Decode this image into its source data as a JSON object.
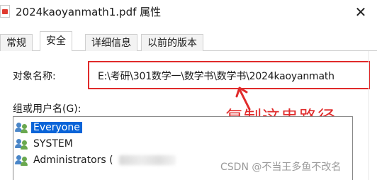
{
  "window": {
    "title": "2024kaoyanmath1.pdf 属性",
    "file_icon": "pdf-file-icon",
    "close_glyph": "✕"
  },
  "tabs": [
    {
      "label": "常规",
      "active": false
    },
    {
      "label": "安全",
      "active": true
    },
    {
      "label": "详细信息",
      "active": false
    },
    {
      "label": "以前的版本",
      "active": false
    }
  ],
  "security": {
    "object_name_label": "对象名称:",
    "object_name_value": "E:\\考研\\301数学一\\数学书\\数学书\\2024kaoyanmath",
    "group_label": "组或用户名(G):",
    "users": [
      {
        "name": "Everyone",
        "selected": true,
        "icon": "users-group-icon"
      },
      {
        "name": "SYSTEM",
        "selected": false,
        "icon": "users-group-icon"
      },
      {
        "name": "Administrators (",
        "selected": false,
        "icon": "users-group-icon"
      }
    ]
  },
  "annotation": {
    "text": "复制这串路径",
    "color": "#e02b2b"
  },
  "watermark": "CSDN @不当王多鱼不改名",
  "colors": {
    "selection": "#0a64d8",
    "annotation_red": "#e02b2b"
  }
}
